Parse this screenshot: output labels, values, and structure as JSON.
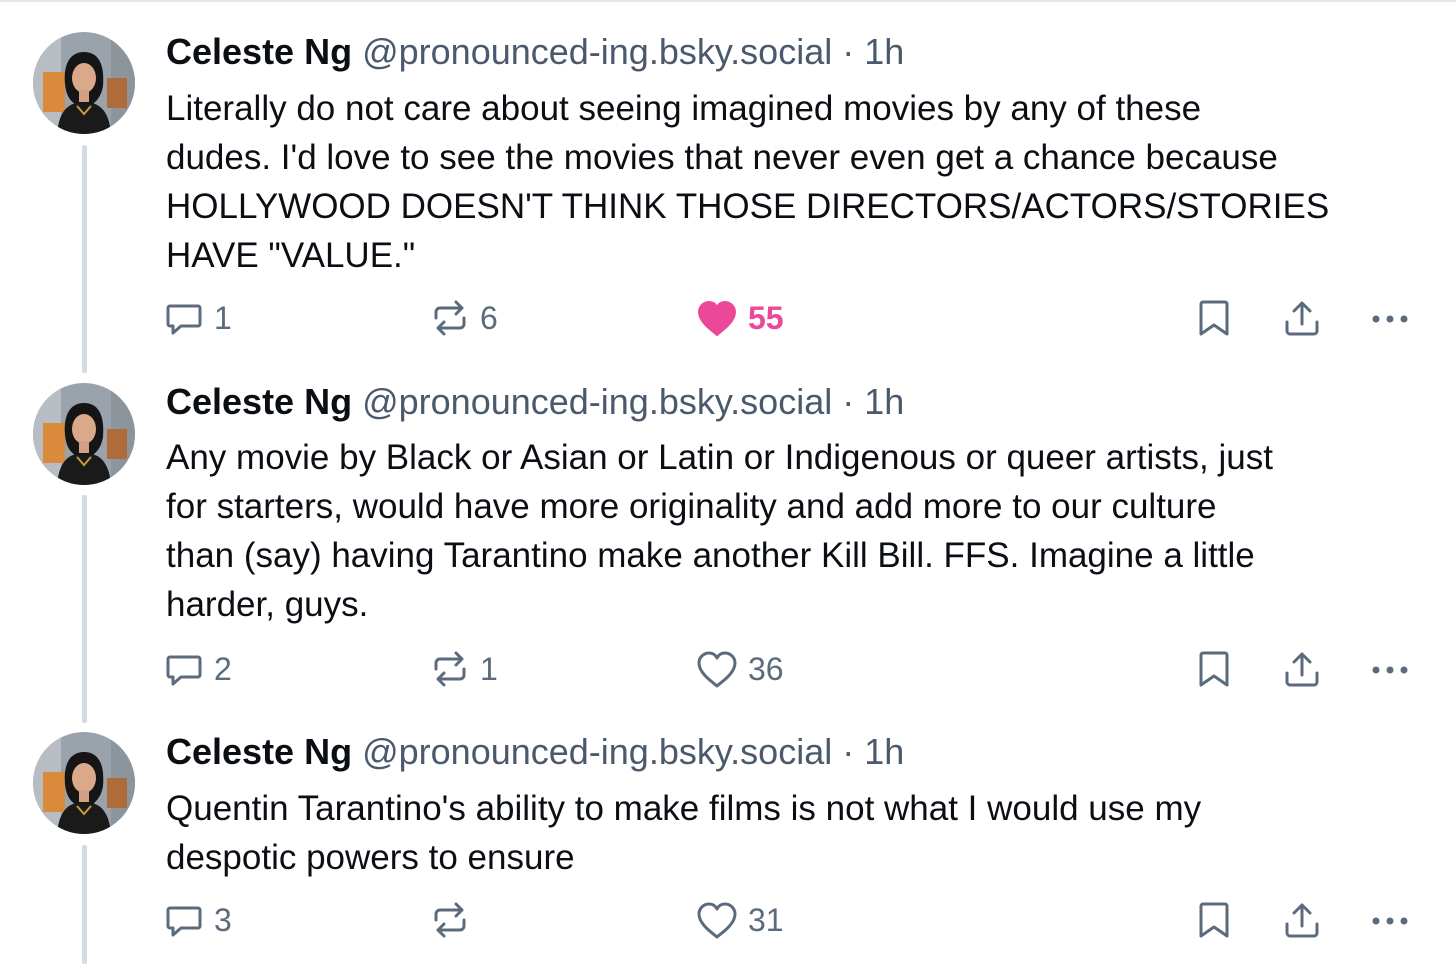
{
  "posts": [
    {
      "author": "Celeste Ng",
      "handle": "@pronounced-ing.bsky.social",
      "separator": "·",
      "time": "1h",
      "text": "Literally do not care about seeing imagined movies by any of these\ndudes. I'd love to see the movies that never even get a chance because\nHOLLYWOOD DOESN'T THINK THOSE DIRECTORS/ACTORS/STORIES\nHAVE \"VALUE.\"",
      "replies": "1",
      "reposts": "6",
      "likes": "55",
      "liked": true
    },
    {
      "author": "Celeste Ng",
      "handle": "@pronounced-ing.bsky.social",
      "separator": "·",
      "time": "1h",
      "text": "Any movie by Black or Asian or Latin or Indigenous or queer artists, just\nfor starters, would have more originality and add more to our culture\nthan (say) having Tarantino make another Kill Bill. FFS. Imagine a little\nharder, guys.",
      "replies": "2",
      "reposts": "1",
      "likes": "36",
      "liked": false
    },
    {
      "author": "Celeste Ng",
      "handle": "@pronounced-ing.bsky.social",
      "separator": "·",
      "time": "1h",
      "text": "Quentin Tarantino's ability to make films is not what I would use my\ndespotic powers to ensure",
      "replies": "3",
      "reposts": "",
      "likes": "31",
      "liked": false
    }
  ],
  "icons": {
    "reply": "speech-bubble-icon",
    "repost": "repost-arrows-icon",
    "like": "heart-icon",
    "bookmark": "bookmark-icon",
    "share": "share-upload-icon",
    "more": "ellipsis-icon"
  },
  "colors": {
    "like_active": "#ec4899",
    "icon_gray": "#5b6b7d",
    "handle_gray": "#4a5a6c",
    "thread_line": "#d4dbe2"
  }
}
